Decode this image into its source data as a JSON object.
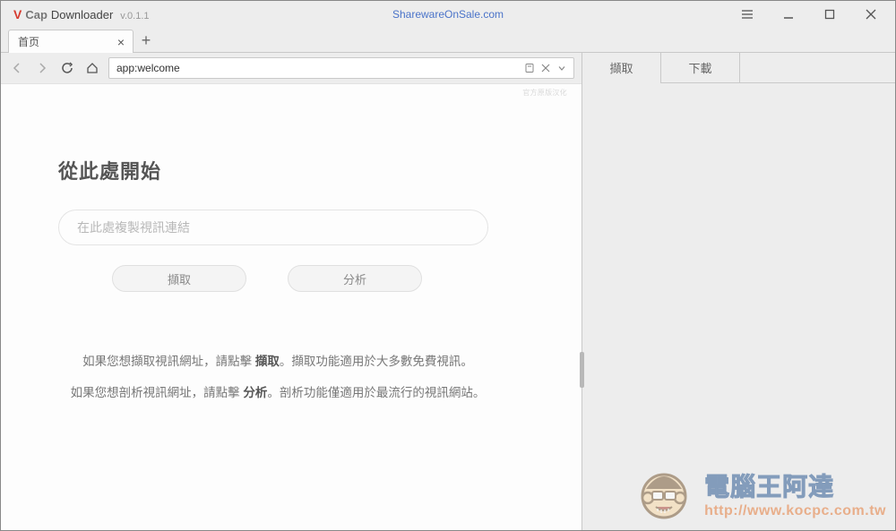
{
  "titlebar": {
    "brand_v": "V",
    "brand_cap": "Cap",
    "brand_name": "Downloader",
    "version": "v.0.1.1",
    "center": "SharewareOnSale.com"
  },
  "tab": {
    "title": "首页"
  },
  "address": {
    "value": "app:welcome"
  },
  "content": {
    "srclabel": "官方原版汉化",
    "heading": "從此處開始",
    "url_placeholder": "在此處複製視訊連結",
    "btn_capture": "擷取",
    "btn_analyze": "分析",
    "hint1_pre": "如果您想擷取視訊網址，請點擊 ",
    "hint1_bold": "擷取",
    "hint1_post": "。擷取功能適用於大多數免費視訊。",
    "hint2_pre": "如果您想剖析視訊網址，請點擊 ",
    "hint2_bold": "分析",
    "hint2_post": "。剖析功能僅適用於最流行的視訊網站。"
  },
  "rightpanel": {
    "tab_capture": "擷取",
    "tab_download": "下載"
  },
  "watermark": {
    "cn": "電腦王阿達",
    "url": "http://www.kocpc.com.tw"
  }
}
